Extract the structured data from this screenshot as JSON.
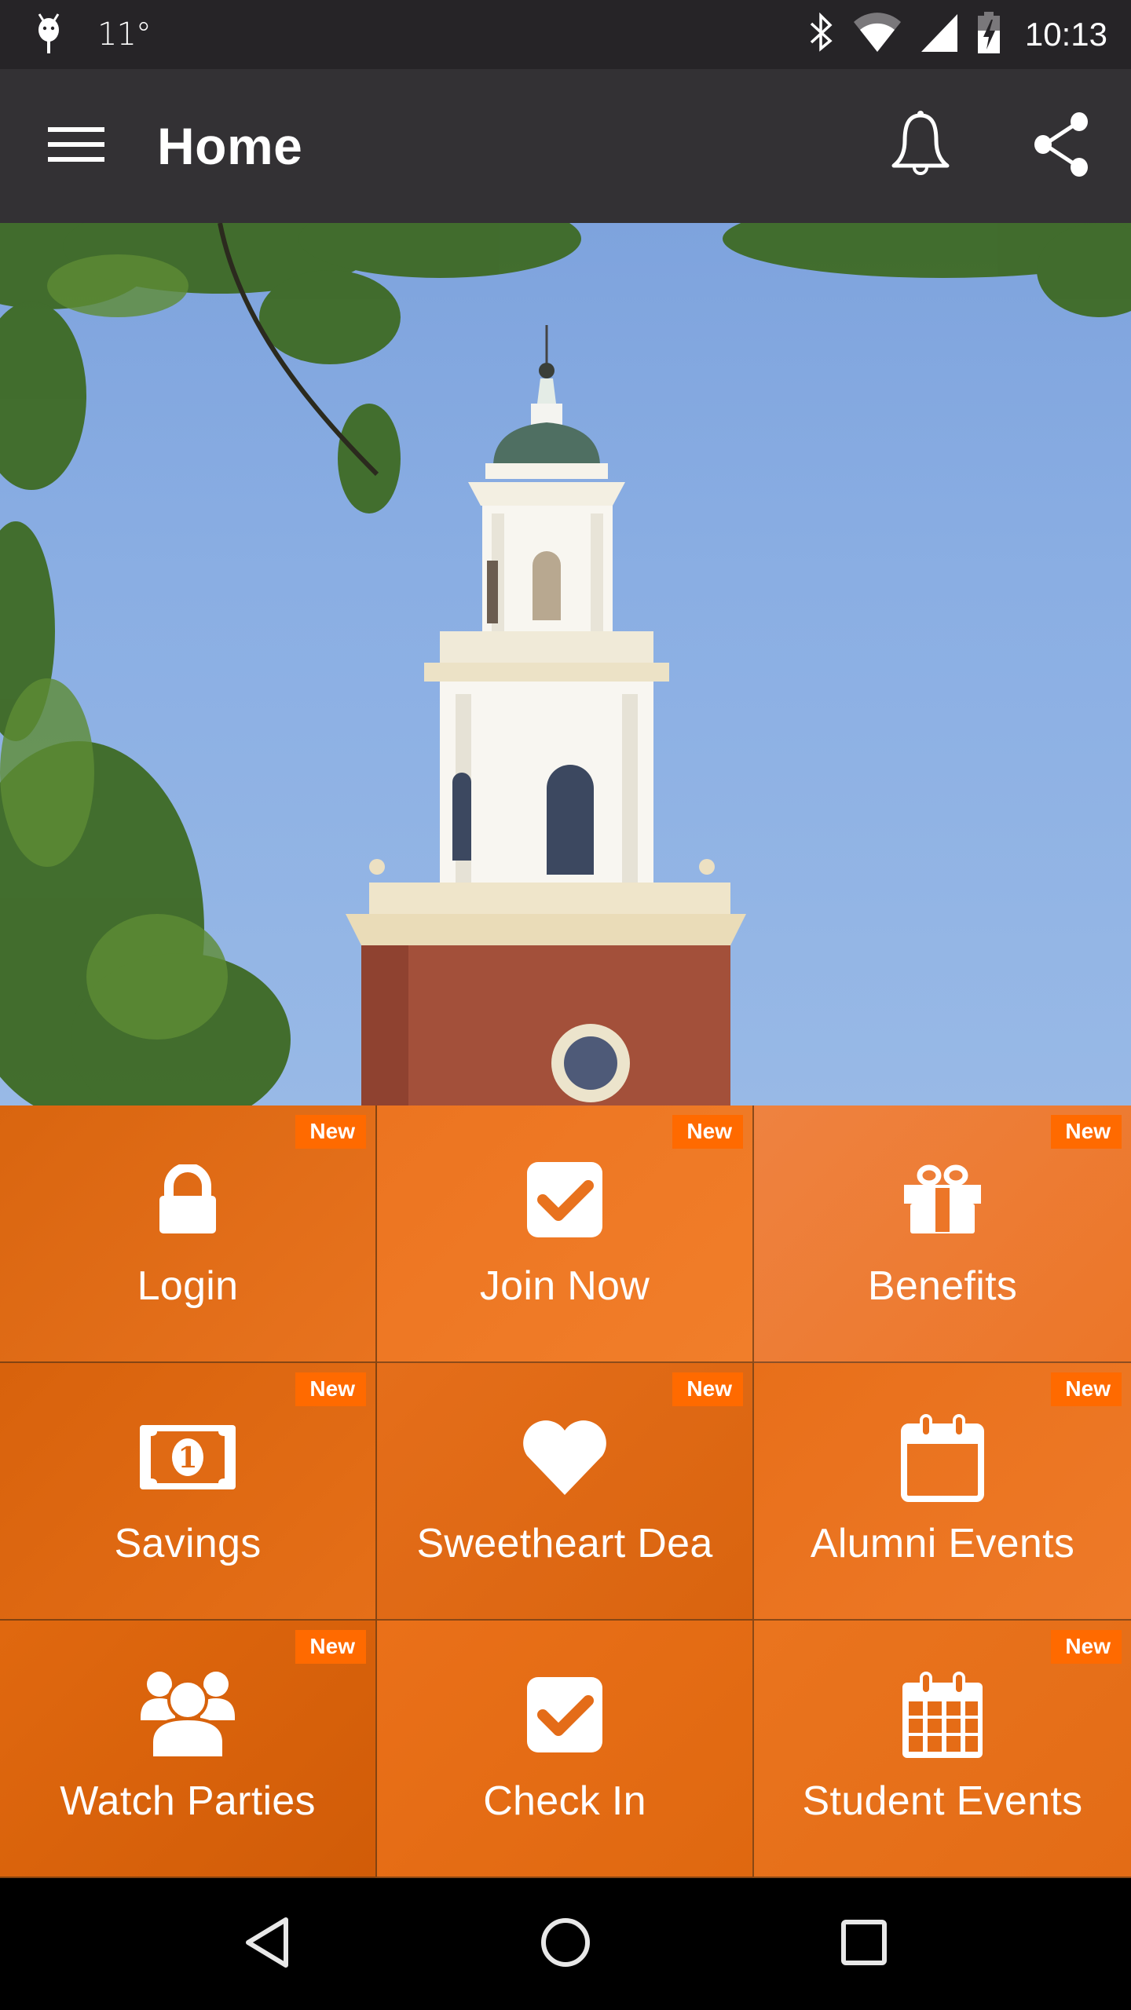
{
  "status_bar": {
    "notification_icon": "android-debug-icon",
    "temperature": "11°",
    "icons": [
      "bluetooth-icon",
      "wifi-icon",
      "cell-signal-icon",
      "battery-charging-icon"
    ],
    "time": "10:13"
  },
  "app_bar": {
    "menu_icon": "hamburger-menu-icon",
    "title": "Home",
    "actions": [
      {
        "name": "notifications",
        "icon": "bell-icon"
      },
      {
        "name": "share",
        "icon": "share-icon"
      }
    ]
  },
  "hero": {
    "description": "Campus clock tower with white cupola and green dome against blue sky, framed by tree branches"
  },
  "colors": {
    "status_bar_bg": "#262427",
    "app_bar_bg": "#333134",
    "tile_overlay": "#f06c14",
    "badge_bg": "#ff6a00",
    "nav_bar_bg": "#000000"
  },
  "tiles": [
    {
      "label": "Login",
      "icon": "lock-icon",
      "badge": "New"
    },
    {
      "label": "Join Now",
      "icon": "checkbox-icon",
      "badge": "New"
    },
    {
      "label": "Benefits",
      "icon": "gift-icon",
      "badge": "New"
    },
    {
      "label": "Savings",
      "icon": "dollar-bill-icon",
      "badge": "New"
    },
    {
      "label": "Sweetheart Dea",
      "icon": "heart-icon",
      "badge": "New"
    },
    {
      "label": "Alumni Events",
      "icon": "calendar-icon",
      "badge": "New"
    },
    {
      "label": "Watch Parties",
      "icon": "group-icon",
      "badge": "New"
    },
    {
      "label": "Check In",
      "icon": "checkbox-icon",
      "badge": ""
    },
    {
      "label": "Student Events",
      "icon": "calendar-grid-icon",
      "badge": "New"
    }
  ],
  "nav_bar": {
    "buttons": [
      {
        "name": "back",
        "icon": "back-triangle-icon"
      },
      {
        "name": "home",
        "icon": "home-circle-icon"
      },
      {
        "name": "recents",
        "icon": "recents-square-icon"
      }
    ]
  }
}
